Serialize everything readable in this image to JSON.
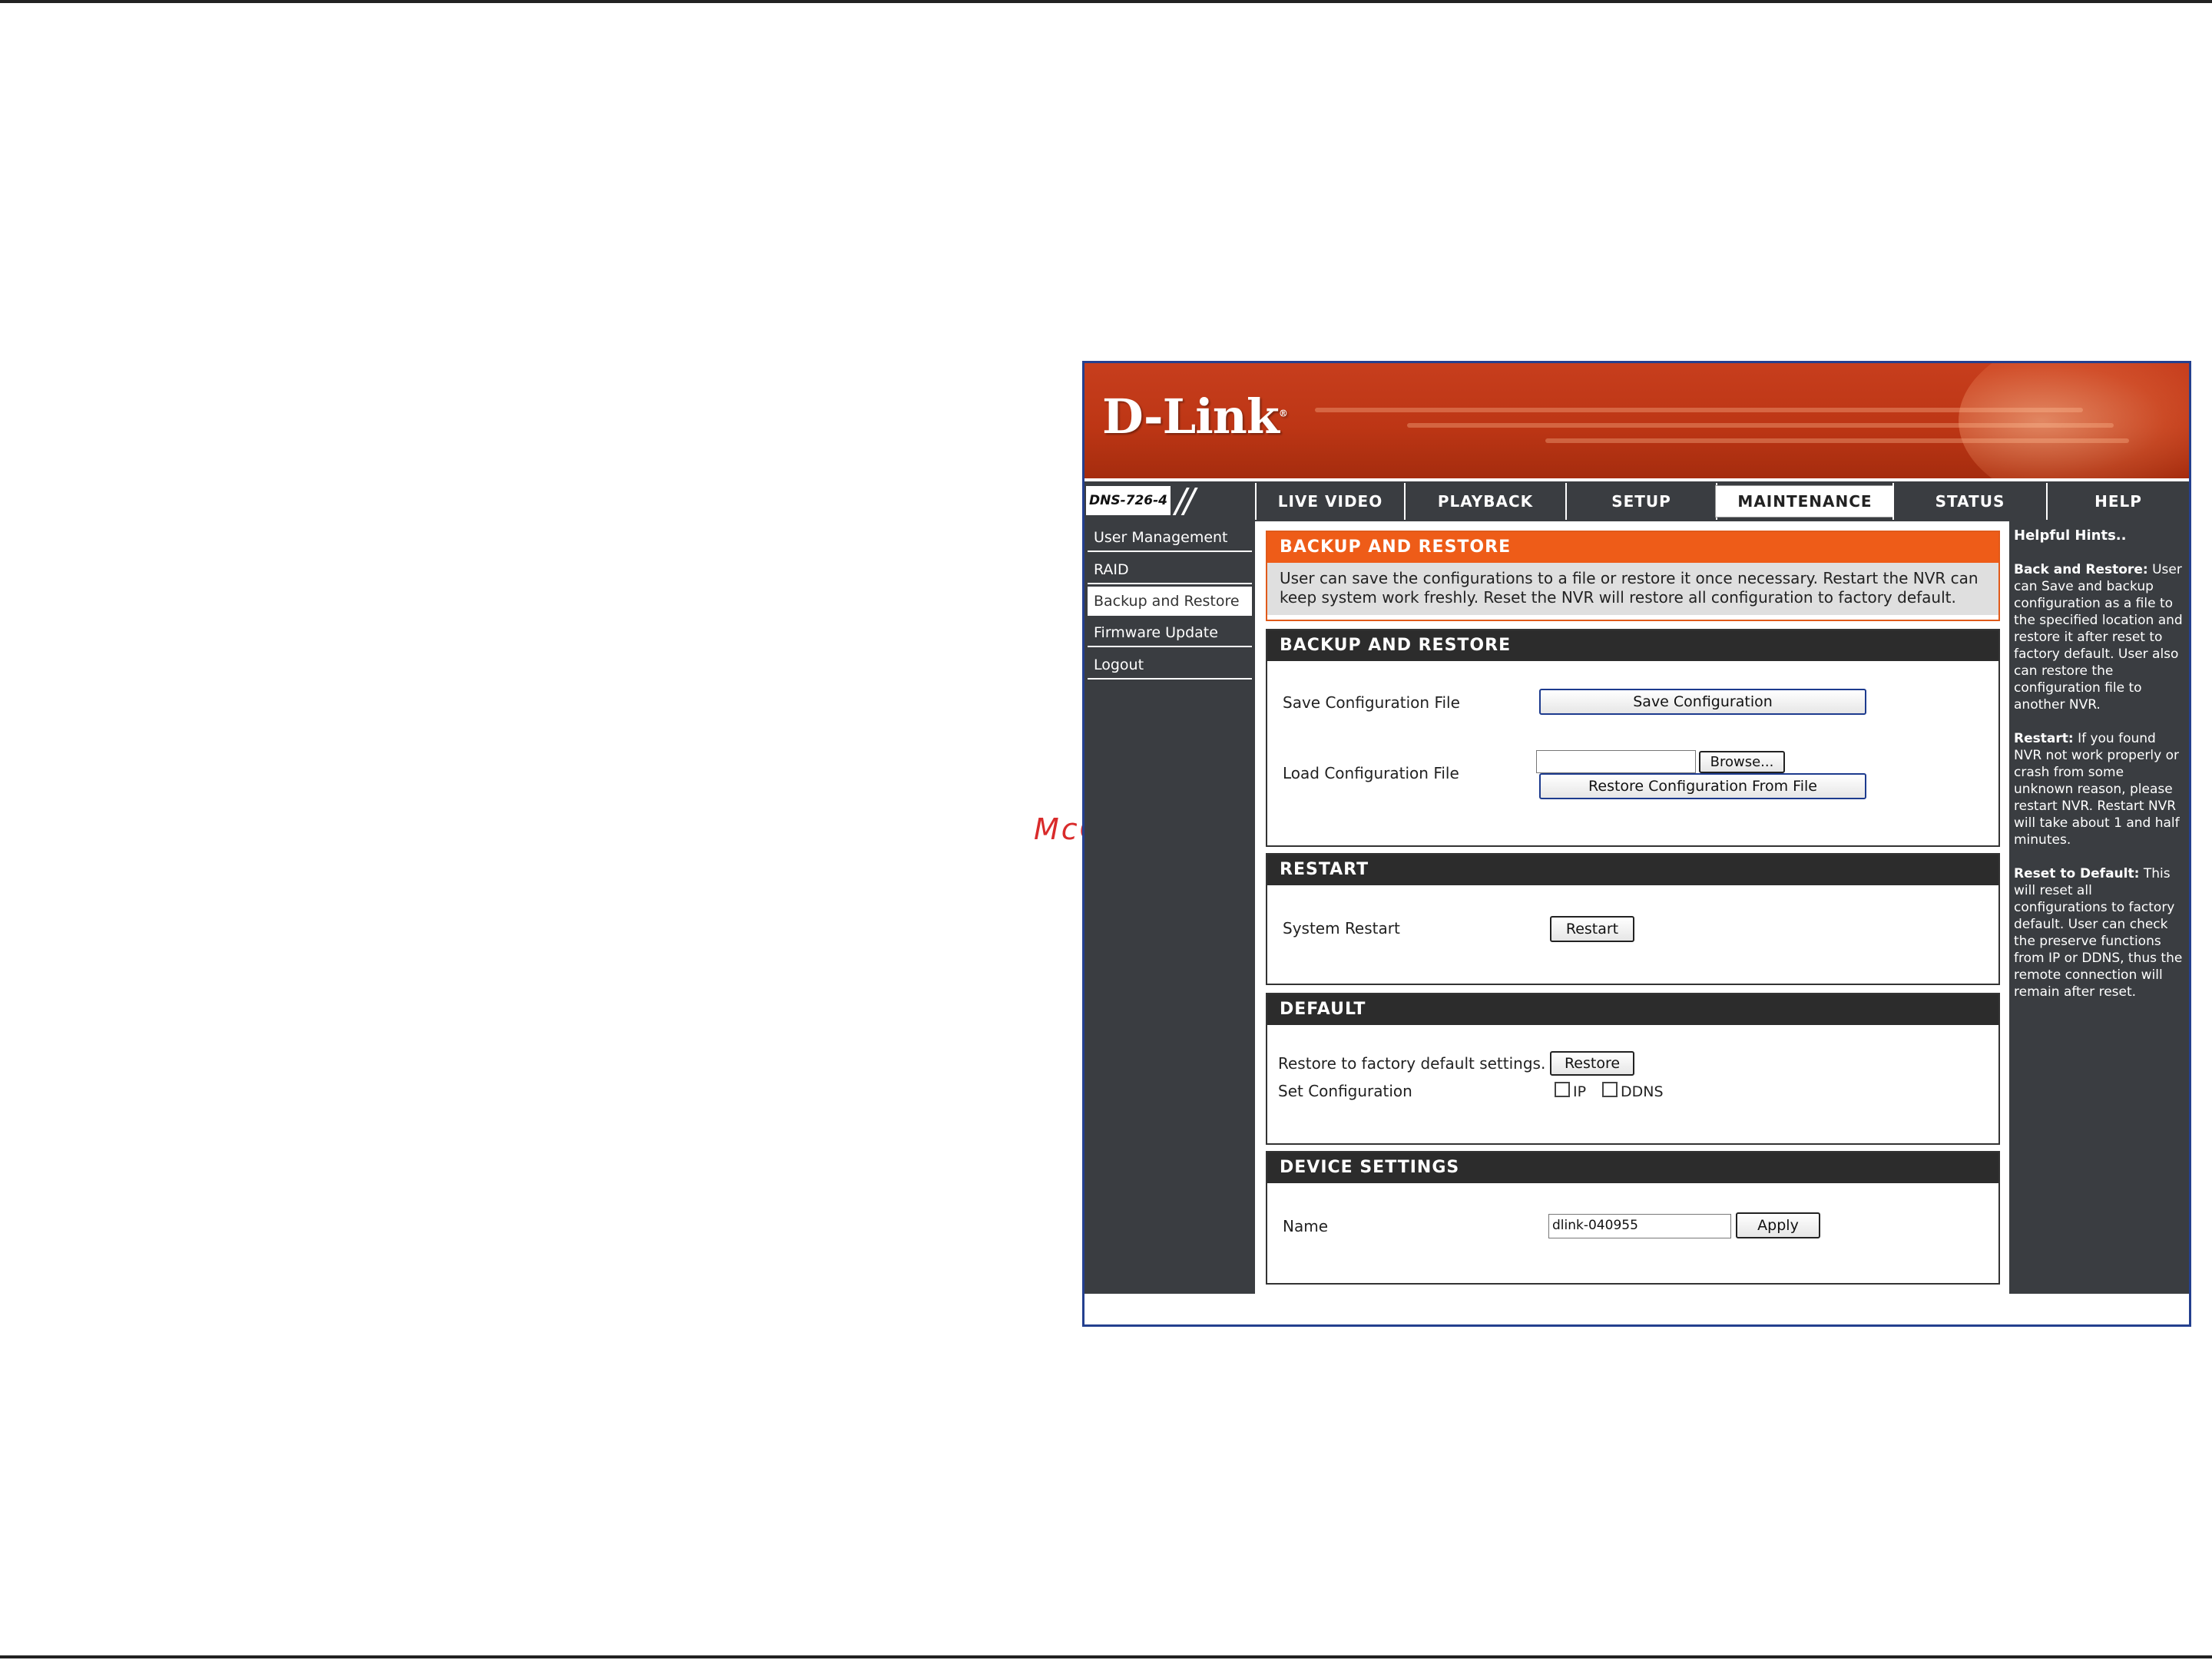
{
  "watermark": "McGrp.Ru",
  "banner": {
    "logo": "D-Link",
    "logo_mark": "®"
  },
  "navbar": {
    "model": "DNS-726-4",
    "tabs": [
      {
        "label": "LIVE VIDEO"
      },
      {
        "label": "PLAYBACK"
      },
      {
        "label": "SETUP"
      },
      {
        "label": "MAINTENANCE"
      },
      {
        "label": "STATUS"
      },
      {
        "label": "HELP"
      }
    ]
  },
  "sidebar": {
    "items": [
      {
        "label": "User Management"
      },
      {
        "label": "RAID"
      },
      {
        "label": "Backup and Restore"
      },
      {
        "label": "Firmware Update"
      },
      {
        "label": "Logout"
      }
    ]
  },
  "intro": {
    "title": "BACKUP AND RESTORE",
    "text": "User can save the configurations to a file or restore it once necessary. Restart the NVR can keep system work freshly. Reset the NVR will restore all configuration to factory default."
  },
  "backup": {
    "title": "BACKUP AND RESTORE",
    "save_label": "Save Configuration File",
    "save_button": "Save Configuration",
    "load_label": "Load Configuration File",
    "file_value": "",
    "browse_button": "Browse...",
    "restore_file_button": "Restore Configuration From File"
  },
  "restart": {
    "title": "RESTART",
    "label": "System Restart",
    "button": "Restart"
  },
  "default": {
    "title": "DEFAULT",
    "restore_label": "Restore to factory default settings.",
    "restore_button": "Restore",
    "set_label": "Set Configuration",
    "ip_label": "IP",
    "ip_checked": false,
    "ddns_label": "DDNS",
    "ddns_checked": false
  },
  "device": {
    "title": "DEVICE SETTINGS",
    "name_label": "Name",
    "name_value": "dlink-040955",
    "apply_button": "Apply"
  },
  "hints": {
    "title": "Helpful Hints..",
    "items": [
      {
        "heading": "Back and Restore:",
        "text": "User can Save and backup configuration as a file to the specified location and restore it after reset to factory default. User also can restore the configuration file to another NVR."
      },
      {
        "heading": "Restart:",
        "text": "If you found NVR not work properly or crash from some unknown reason, please restart NVR. Restart NVR will take about 1 and half minutes."
      },
      {
        "heading": "Reset to Default:",
        "text": "This will reset all configurations to factory default. User can check the preserve functions from IP or DDNS, thus the remote connection will remain after reset."
      }
    ]
  }
}
